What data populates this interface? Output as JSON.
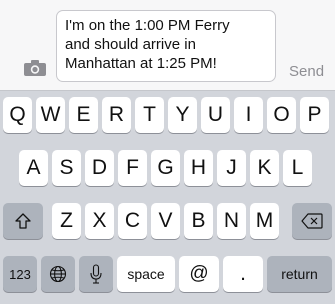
{
  "compose": {
    "message_lines": [
      "I'm on the 1:00 PM Ferry",
      "and should arrive in",
      "Manhattan at 1:25 PM!"
    ],
    "send_label": "Send",
    "camera_icon": "camera-icon"
  },
  "keyboard": {
    "row1": [
      "Q",
      "W",
      "E",
      "R",
      "T",
      "Y",
      "U",
      "I",
      "O",
      "P"
    ],
    "row2": [
      "A",
      "S",
      "D",
      "F",
      "G",
      "H",
      "J",
      "K",
      "L"
    ],
    "row3": [
      "Z",
      "X",
      "C",
      "V",
      "B",
      "N",
      "M"
    ],
    "shift_icon": "shift-icon",
    "delete_icon": "delete-icon",
    "numbers_label": "123",
    "globe_icon": "globe-icon",
    "mic_icon": "microphone-icon",
    "space_label": "space",
    "at_label": "@",
    "period_label": ".",
    "return_label": "return"
  },
  "colors": {
    "keyboard_bg": "#d2d5db",
    "key_bg": "#ffffff",
    "dark_key_bg": "#adb3bc",
    "send_text": "#8e8e93"
  }
}
